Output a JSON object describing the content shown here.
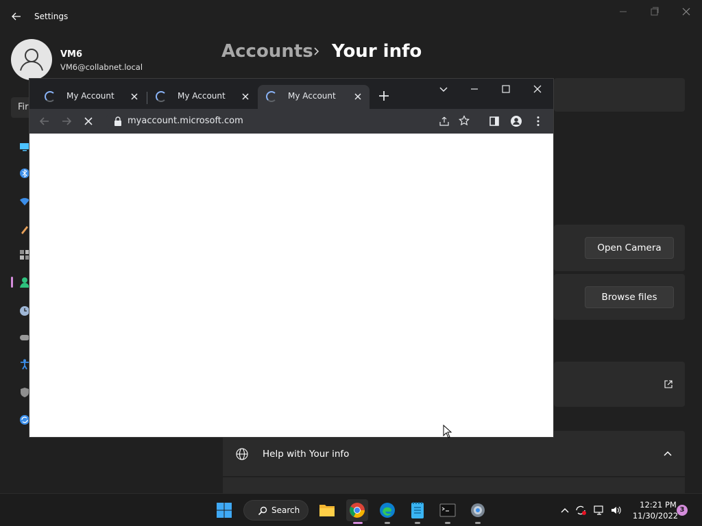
{
  "settings": {
    "title": "Settings",
    "profile": {
      "name": "VM6",
      "email": "VM6@collabnet.local"
    },
    "breadcrumb": {
      "parent": "Accounts",
      "current": "Your info"
    },
    "search_partial": "Fir",
    "nav_icons": [
      "system-icon",
      "bluetooth-icon",
      "wifi-icon",
      "personalization-icon",
      "apps-icon",
      "accounts-icon",
      "time-language-icon",
      "gaming-icon",
      "accessibility-icon",
      "privacy-icon",
      "windows-update-icon"
    ],
    "buttons": {
      "open_camera": "Open Camera",
      "browse_files": "Browse files"
    },
    "help": {
      "label": "Help with Your info"
    }
  },
  "browser": {
    "tabs": [
      {
        "title": "My Account",
        "active": false
      },
      {
        "title": "My Account",
        "active": false
      },
      {
        "title": "My Account",
        "active": true
      }
    ],
    "url": "myaccount.microsoft.com",
    "loading": true
  },
  "taskbar": {
    "search_label": "Search",
    "apps": [
      "start-icon",
      "file-explorer-icon",
      "chrome-icon",
      "edge-icon",
      "notepad-icon",
      "terminal-icon",
      "settings-icon"
    ],
    "time": "12:21 PM",
    "date": "11/30/2022",
    "notification_count": "3"
  },
  "colors": {
    "accent": "#d48cdb",
    "settings_bg": "#202020",
    "card_bg": "#2b2b2b",
    "chrome_frame": "#202124",
    "chrome_toolbar": "#35363a",
    "chrome_blue": "#8ab4f8"
  }
}
